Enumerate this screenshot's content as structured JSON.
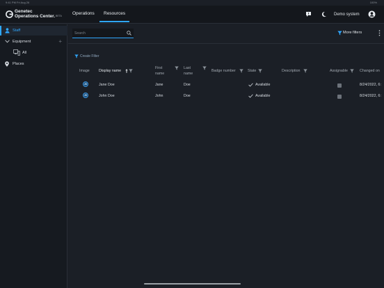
{
  "status_bar": {
    "left": "9:41 PM   Fri Aug 26",
    "right": "100%"
  },
  "app": {
    "logo_line1": "Genetec",
    "logo_line2": "Operations Center.",
    "logo_badge": "BETA"
  },
  "nav": {
    "tabs": [
      {
        "label": "Operations"
      },
      {
        "label": "Resources",
        "active": true
      }
    ]
  },
  "header": {
    "user_label": "Demo system",
    "icons": [
      "feedback-icon",
      "dark-mode-icon",
      "user-icon"
    ]
  },
  "sidebar": {
    "items": [
      {
        "label": "Staff",
        "icon": "person-icon",
        "active": true
      },
      {
        "label": "Equipment",
        "icon": "chevron-down-icon",
        "expanded": true
      },
      {
        "label": "All",
        "icon": "equipment-icon",
        "child": true
      },
      {
        "label": "Places",
        "icon": "pin-icon"
      }
    ]
  },
  "toolbar": {
    "search_placeholder": "Search",
    "more_filters": "More filters"
  },
  "create_filter": "Create Filter",
  "table": {
    "headers": {
      "image": "Image",
      "display_name": "Display name",
      "first_name_1": "First",
      "first_name_2": "name",
      "last_name_1": "Last",
      "last_name_2": "name",
      "badge_number": "Badge number",
      "state": "State",
      "description": "Description",
      "assignable": "Assignable",
      "changed_on": "Changed on"
    },
    "rows": [
      {
        "initials": "JD",
        "display_name": "Jane Doe",
        "first_name": "Jane",
        "last_name": "Doe",
        "badge_number": "",
        "state": "Available",
        "description": "",
        "assignable": true,
        "changed_on": "8/24/2022, 6:"
      },
      {
        "initials": "JD",
        "display_name": "John Doe",
        "first_name": "John",
        "last_name": "Doe",
        "badge_number": "",
        "state": "Available",
        "description": "",
        "assignable": true,
        "changed_on": "8/24/2022, 6:"
      }
    ]
  },
  "colors": {
    "accent": "#2fa7ff",
    "background": "#1b1f26",
    "topbar": "#14171c",
    "sidebar": "#161a20"
  }
}
